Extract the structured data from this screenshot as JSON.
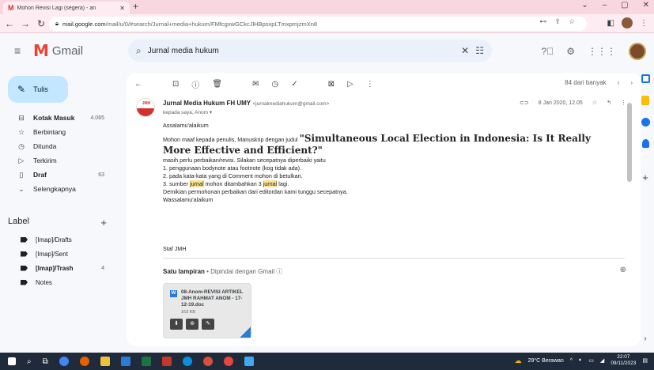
{
  "browser": {
    "tab_title": "Mohon Revisi Lagi (segera) - an",
    "url_host": "mail.google.com",
    "url_path": "/mail/u/0/#search/Jurnal+media+hukum/FMfcgxwGCkcJlHBpsxpLTmxpmjzmXn8"
  },
  "gmail": {
    "brand": "Gmail",
    "search_query": "Jurnal media hukum",
    "compose_label": "Tulis"
  },
  "nav": [
    {
      "label": "Kotak Masuk",
      "count": "4.065",
      "icon": "inbox-icon",
      "bold": true
    },
    {
      "label": "Berbintang",
      "count": "",
      "icon": "star-icon",
      "bold": false
    },
    {
      "label": "Ditunda",
      "count": "",
      "icon": "clock-icon",
      "bold": false
    },
    {
      "label": "Terkirim",
      "count": "",
      "icon": "send-icon",
      "bold": false
    },
    {
      "label": "Draf",
      "count": "63",
      "icon": "draft-icon",
      "bold": true
    },
    {
      "label": "Selengkapnya",
      "count": "",
      "icon": "chevron-down-icon",
      "bold": false
    }
  ],
  "labels_heading": "Label",
  "labels": [
    {
      "label": "[Imap]/Drafts",
      "count": "",
      "bold": false
    },
    {
      "label": "[Imap]/Sent",
      "count": "",
      "bold": false
    },
    {
      "label": "[Imap]/Trash",
      "count": "4",
      "bold": true
    },
    {
      "label": "Notes",
      "count": "",
      "bold": false
    }
  ],
  "toolbar": {
    "pager_text": "84 dari banyak"
  },
  "message": {
    "avatar_text": "JMH",
    "sender_name": "Jurnal Media Hukum FH UMY",
    "sender_email": "<jurnalmediahukum@gmail.com>",
    "to_line": "kepada saya, Anom",
    "date": "8 Jan 2020, 12.05",
    "greeting": "Assalamu'alaikum",
    "intro": "Mohon maaf kepada penulis, Manuskrip dengan judul ",
    "title_quote": "\"Simultaneous Local Election in Indonesia: Is It Really More Effective and Efficient?\"",
    "line1": "masih perlu perbaikan/revisi. Silakan secepatnya diperbaiki  yaitu",
    "item1": "1. penggunaan bodynote atau footnote (kog tidak ada).",
    "item2": "2. pada kata-kata yang di Comment mohon di betulkan.",
    "item3_a": "3. sumber ",
    "item3_hl1": "jurnal",
    "item3_b": " mohon ditambahkan 3 ",
    "item3_hl2": "jurnal",
    "item3_c": " lagi.",
    "closing1": "Demikian permohonan perbaikan dari editordan kami tunggu secepatnya.",
    "closing2": "Wassalamu'alaikum",
    "signature": "Staf JMH"
  },
  "attachment": {
    "heading": "Satu lampiran",
    "scan_note": " • Dipindai dengan Gmail ⓘ",
    "filename": "08-Anom-REVISI ARTIKEL JMH RAHMAT ANOM - 17-12-19.doc",
    "size": "163 KB"
  },
  "taskbar": {
    "weather": "29°C Berawan",
    "time": "22:07",
    "date": "09/11/2023"
  },
  "colors": {
    "accent": "#c2e7ff",
    "highlight": "#fde293",
    "brand_red": "#ea4335"
  }
}
